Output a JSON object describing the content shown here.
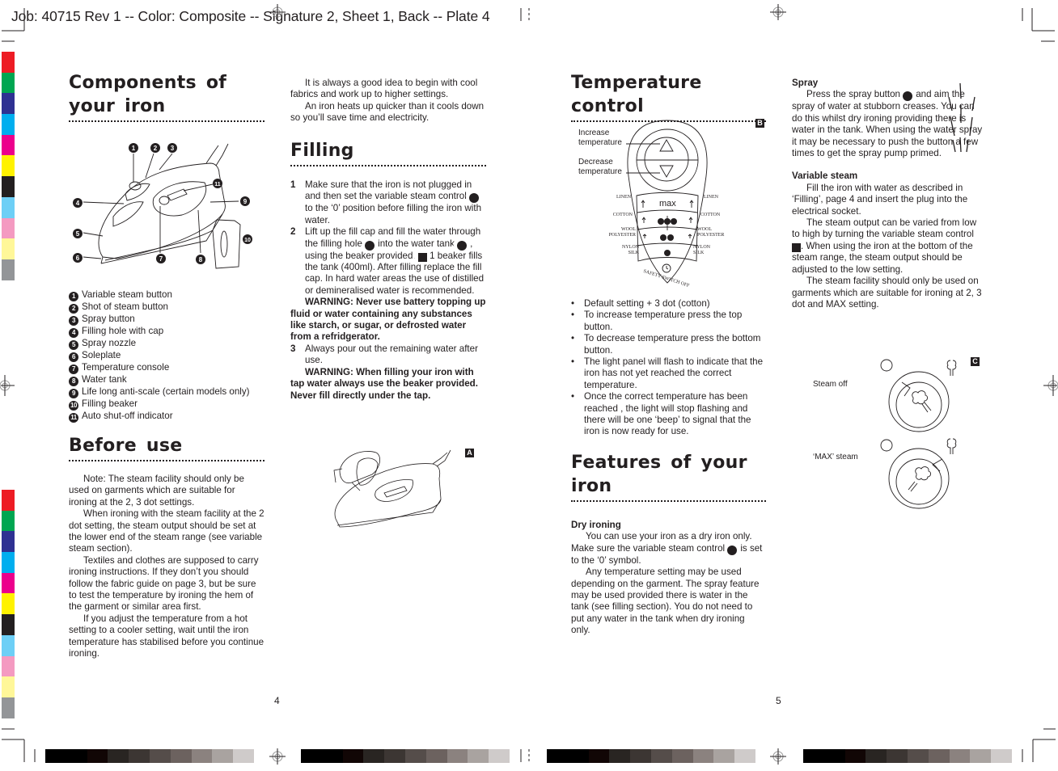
{
  "slug": "Job: 40715 Rev 1 -- Color: Composite -- Signature 2, Sheet 1, Back -- Plate 4",
  "print_marks": {
    "color_swatches": [
      "#ed1c24",
      "#00a651",
      "#2e3192",
      "#00aeef",
      "#ec008c",
      "#fff200",
      "#231f20",
      "#6dcff6",
      "#f49ac1",
      "#fff799",
      "#939598"
    ],
    "gray_steps": [
      "#000000",
      "#000000",
      "#110605",
      "#292522",
      "#3c3633",
      "#554d4a",
      "#6c625f",
      "#8b827f",
      "#a9a3a0",
      "#cfcbca"
    ]
  },
  "left_page": {
    "components": {
      "title": "Components of your iron",
      "items": [
        {
          "n": "1",
          "label": "Variable steam button"
        },
        {
          "n": "2",
          "label": "Shot of steam button"
        },
        {
          "n": "3",
          "label": "Spray button"
        },
        {
          "n": "4",
          "label": "Filling hole with cap"
        },
        {
          "n": "5",
          "label": "Spray nozzle"
        },
        {
          "n": "6",
          "label": "Soleplate"
        },
        {
          "n": "7",
          "label": "Temperature console"
        },
        {
          "n": "8",
          "label": "Water tank"
        },
        {
          "n": "9",
          "label": "Life long anti-scale (certain models only)"
        },
        {
          "n": "10",
          "label": "Filling beaker"
        },
        {
          "n": "11",
          "label": "Auto shut-off indicator"
        }
      ]
    },
    "before_use": {
      "title": "Before use",
      "paragraphs": [
        "Note: The steam facility should only be used on garments which are suitable for ironing at the 2, 3 dot settings.",
        "When ironing with the steam facility at the 2 dot setting, the steam output should be set at the lower end of the steam range (see variable steam section).",
        "Textiles and clothes are supposed to carry ironing instructions. If they don’t you should follow the fabric guide on page 3, but be sure to test the temperature by ironing the hem of the garment or similar area first.",
        "If you adjust the temperature from a hot setting to a cooler setting, wait until the iron temperature has stabilised before you continue ironing."
      ]
    },
    "intro": [
      "It is always a good idea to begin with cool fabrics and work up to higher settings.",
      "An iron heats up quicker than it cools down so you’ll save time and electricity."
    ],
    "filling": {
      "title": "Filling",
      "step1_a": "Make sure that the iron is not plugged in and then set the variable steam control",
      "step1_b": "to the ‘0’ position before filling the iron with water.",
      "step2_a": "Lift up the fill cap and fill the water through the filling hole",
      "step2_b": "into the water tank",
      "step2_c": ", using the beaker provided.",
      "step2_d": "1 beaker fills the tank (400ml). After filling replace the fill cap. In hard water areas the use of distilled or demineralised water is recommended.",
      "warning1": "WARNING: Never use battery topping up fluid or water containing any substances like starch, or sugar, or defrosted water from a refridgerator.",
      "step3": "Always pour out the remaining water after use.",
      "warning2": "WARNING: When filling your iron with tap water always use the beaker provided. Never fill directly under the tap.",
      "figure_label": "A"
    },
    "page_number": "4"
  },
  "right_page": {
    "temperature": {
      "title": "Temperature control",
      "figure_label": "B",
      "increase_label": "Increase temperature",
      "decrease_label": "Decrease temperature",
      "console": {
        "max_label": "max",
        "fabrics_left": [
          "LINEN",
          "COTTON",
          "WOOL POLYESTER",
          "NYLON SILK"
        ],
        "fabrics_right": [
          "LINEN",
          "COTTON",
          "WOOL POLYESTER",
          "NYLON SILK"
        ],
        "safety_label": "SAFETY SWITCH OFF"
      },
      "bullets": [
        "Default setting + 3 dot (cotton)",
        "To increase temperature press the top button.",
        "To decrease temperature press the bottom button.",
        "The light panel will flash to indicate that the iron has not yet reached the correct temperature.",
        "Once the correct temperature has been reached , the light will stop flashing and there will be one ‘beep’ to signal that the iron is now ready for use."
      ]
    },
    "features": {
      "title": "Features of your iron",
      "dry_ironing": {
        "heading": "Dry ironing",
        "p1_a": "You can use your iron as a dry iron only. Make sure the variable steam control",
        "p1_b": "is set to the ‘0’ symbol.",
        "p2": "Any temperature setting may be used depending on the garment. The spray feature may be used provided there is water in the tank (see filling section). You do not need to put any water in the tank when dry ironing only."
      }
    },
    "spray": {
      "heading": "Spray",
      "p_a": "Press the spray button",
      "p_b": "and aim the spray of water at stubborn creases. You can do this whilst dry ironing providing there is water in the tank. When using the water spray it may be necessary to push the button a few times to get the spray pump primed."
    },
    "variable_steam": {
      "heading": "Variable steam",
      "p1": "Fill the iron with water as described in ‘Filling’, page 4 and insert the plug into the electrical socket.",
      "p2_a": "The steam output can be varied from low to high by turning the variable steam control",
      "p2_b": ". When using the iron at the bottom of the steam range, the steam output should be adjusted to the low setting.",
      "p3": "The steam facility should only be used on garments which are suitable for ironing at 2, 3 dot and MAX setting.",
      "figure_label": "C",
      "steam_off_label": "Steam off",
      "max_steam_label": "‘MAX’ steam"
    },
    "page_number": "5"
  }
}
